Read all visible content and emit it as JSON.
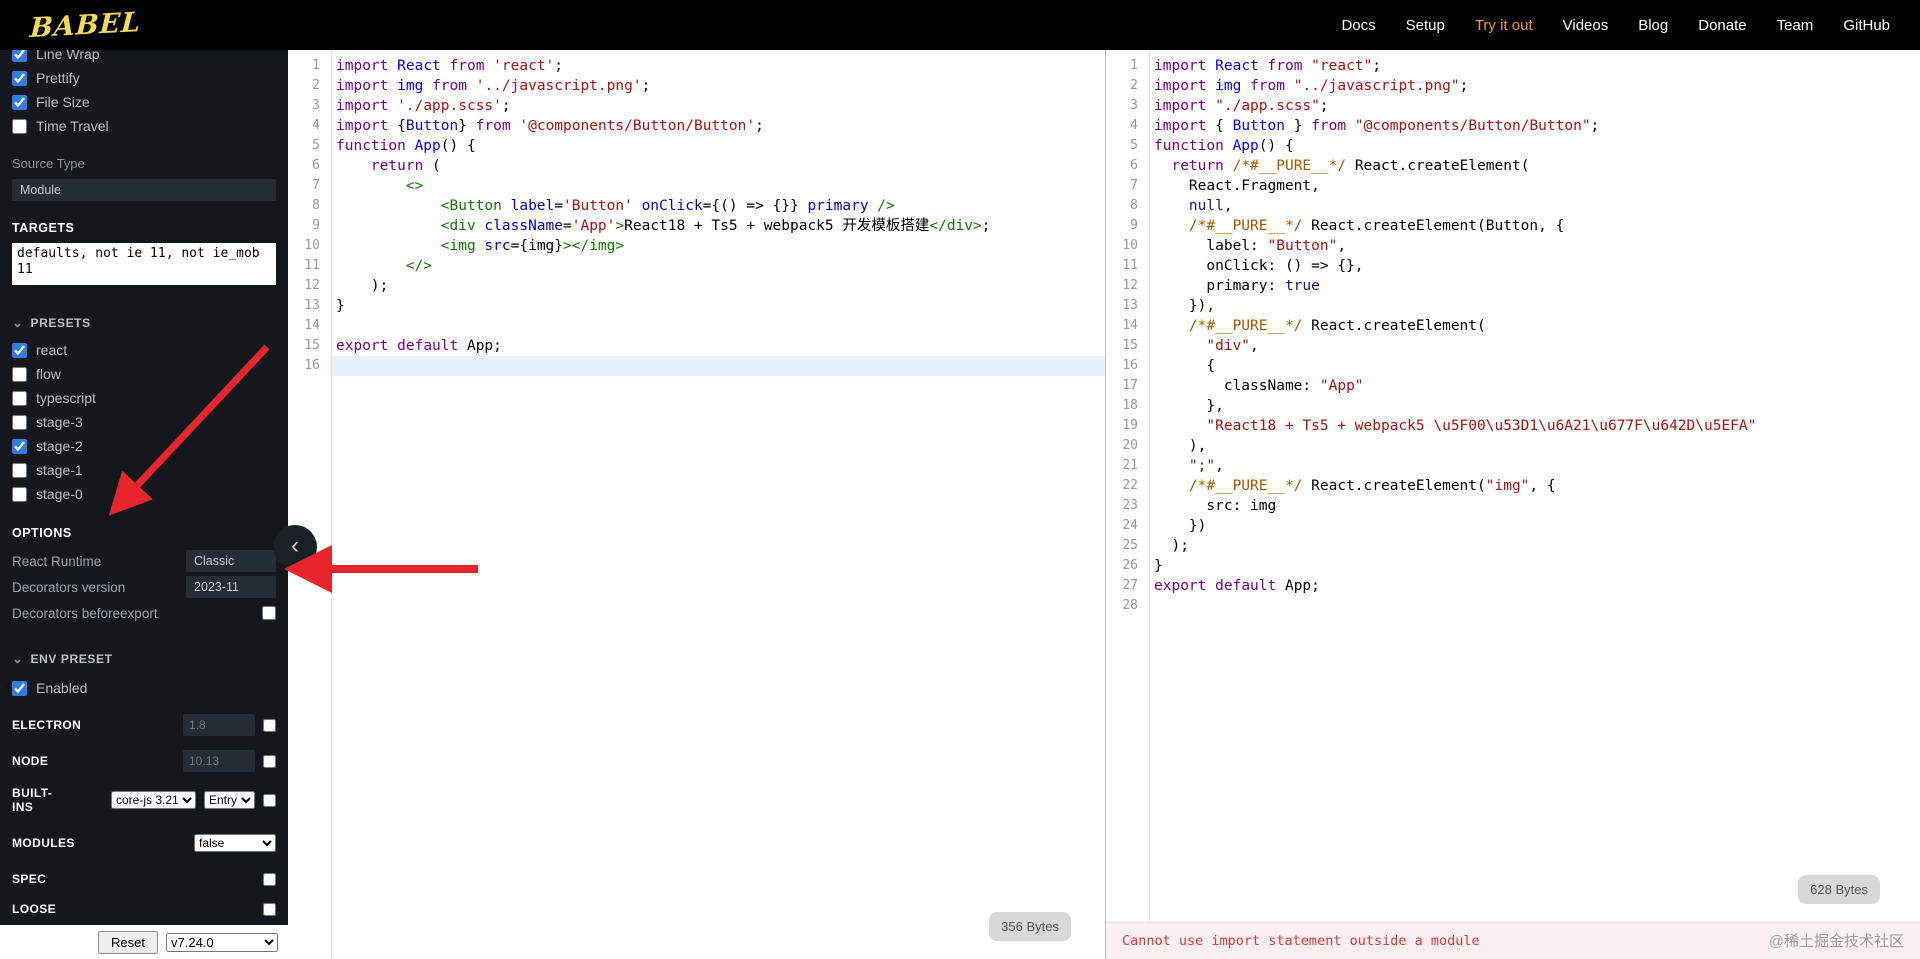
{
  "navbar": {
    "logo": "Babel",
    "items": [
      {
        "label": "Docs",
        "active": false
      },
      {
        "label": "Setup",
        "active": false
      },
      {
        "label": "Try it out",
        "active": true
      },
      {
        "label": "Videos",
        "active": false
      },
      {
        "label": "Blog",
        "active": false
      },
      {
        "label": "Donate",
        "active": false
      },
      {
        "label": "Team",
        "active": false
      },
      {
        "label": "GitHub",
        "active": false
      }
    ]
  },
  "sidebar": {
    "toggles": [
      {
        "label": "Line Wrap",
        "checked": true
      },
      {
        "label": "Prettify",
        "checked": true
      },
      {
        "label": "File Size",
        "checked": true
      },
      {
        "label": "Time Travel",
        "checked": false
      }
    ],
    "source_type": {
      "label": "Source Type",
      "value": "Module"
    },
    "targets": {
      "label": "TARGETS",
      "value": "defaults, not ie 11, not ie_mob 11"
    },
    "presets": {
      "label": "PRESETS",
      "items": [
        {
          "label": "react",
          "checked": true
        },
        {
          "label": "flow",
          "checked": false
        },
        {
          "label": "typescript",
          "checked": false
        },
        {
          "label": "stage-3",
          "checked": false
        },
        {
          "label": "stage-2",
          "checked": true
        },
        {
          "label": "stage-1",
          "checked": false
        },
        {
          "label": "stage-0",
          "checked": false
        }
      ]
    },
    "options": {
      "label": "OPTIONS",
      "react_runtime": {
        "label": "React Runtime",
        "value": "Classic"
      },
      "decorators_version": {
        "label": "Decorators version",
        "value": "2023-11"
      },
      "decorators_before_export": {
        "label": "Decorators beforeexport",
        "checked": false
      }
    },
    "env_preset": {
      "label": "ENV PRESET",
      "enabled": {
        "label": "Enabled",
        "checked": true
      },
      "electron": {
        "label": "ELECTRON",
        "value": "1.8",
        "checked": false
      },
      "node": {
        "label": "NODE",
        "value": "10.13",
        "checked": false
      },
      "builtins": {
        "label": "BUILT-INS",
        "select1": "core-js 3.21",
        "select2": "Entry",
        "checked": false
      },
      "modules": {
        "label": "MODULES",
        "value": "false"
      },
      "spec": {
        "label": "SPEC",
        "checked": false
      },
      "loose": {
        "label": "LOOSE",
        "checked": false
      }
    },
    "footer": {
      "reset_label": "Reset",
      "version": "v7.24.0"
    }
  },
  "editor": {
    "file_size": "356 Bytes",
    "active_line": 16,
    "lines": [
      [
        [
          "k",
          "import"
        ],
        [
          "p",
          " "
        ],
        [
          "d",
          "React"
        ],
        [
          "p",
          " "
        ],
        [
          "k",
          "from"
        ],
        [
          "p",
          " "
        ],
        [
          "s",
          "'react'"
        ],
        [
          "p",
          ";"
        ]
      ],
      [
        [
          "k",
          "import"
        ],
        [
          "p",
          " "
        ],
        [
          "d",
          "img"
        ],
        [
          "p",
          " "
        ],
        [
          "k",
          "from"
        ],
        [
          "p",
          " "
        ],
        [
          "s",
          "'../javascript.png'"
        ],
        [
          "p",
          ";"
        ]
      ],
      [
        [
          "k",
          "import"
        ],
        [
          "p",
          " "
        ],
        [
          "s",
          "'./app.scss'"
        ],
        [
          "p",
          ";"
        ]
      ],
      [
        [
          "k",
          "import"
        ],
        [
          "p",
          " {"
        ],
        [
          "d",
          "Button"
        ],
        [
          "p",
          "} "
        ],
        [
          "k",
          "from"
        ],
        [
          "p",
          " "
        ],
        [
          "s",
          "'@components/Button/Button'"
        ],
        [
          "p",
          ";"
        ]
      ],
      [
        [
          "k",
          "function"
        ],
        [
          "p",
          " "
        ],
        [
          "d",
          "App"
        ],
        [
          "p",
          "() {"
        ]
      ],
      [
        [
          "p",
          "    "
        ],
        [
          "k",
          "return"
        ],
        [
          "p",
          " ("
        ]
      ],
      [
        [
          "p",
          "        "
        ],
        [
          "t",
          "<>"
        ]
      ],
      [
        [
          "p",
          "            "
        ],
        [
          "t",
          "<Button"
        ],
        [
          "p",
          " "
        ],
        [
          "a",
          "label"
        ],
        [
          "p",
          "="
        ],
        [
          "s",
          "'Button'"
        ],
        [
          "p",
          " "
        ],
        [
          "a",
          "onClick"
        ],
        [
          "p",
          "={() => {}} "
        ],
        [
          "a",
          "primary"
        ],
        [
          "p",
          " "
        ],
        [
          "t",
          "/>"
        ]
      ],
      [
        [
          "p",
          "            "
        ],
        [
          "t",
          "<div"
        ],
        [
          "p",
          " "
        ],
        [
          "a",
          "className"
        ],
        [
          "p",
          "="
        ],
        [
          "s",
          "'App'"
        ],
        [
          "t",
          ">"
        ],
        [
          "p",
          "React18 + Ts5 + webpack5 开发模板搭建"
        ],
        [
          "t",
          "</div>"
        ],
        [
          "p",
          ";"
        ]
      ],
      [
        [
          "p",
          "            "
        ],
        [
          "t",
          "<img"
        ],
        [
          "p",
          " "
        ],
        [
          "a",
          "src"
        ],
        [
          "p",
          "={img}"
        ],
        [
          "t",
          "></img>"
        ]
      ],
      [
        [
          "p",
          "        "
        ],
        [
          "t",
          "</>"
        ]
      ],
      [
        [
          "p",
          "    );"
        ]
      ],
      [
        [
          "p",
          "}"
        ]
      ],
      [],
      [
        [
          "k",
          "export"
        ],
        [
          "p",
          " "
        ],
        [
          "k",
          "default"
        ],
        [
          "p",
          " App;"
        ]
      ],
      []
    ]
  },
  "output": {
    "file_size": "628 Bytes",
    "error": "Cannot use import statement outside a module",
    "lines": [
      [
        [
          "k",
          "import"
        ],
        [
          "p",
          " "
        ],
        [
          "d",
          "React"
        ],
        [
          "p",
          " "
        ],
        [
          "k",
          "from"
        ],
        [
          "p",
          " "
        ],
        [
          "s",
          "\"react\""
        ],
        [
          "p",
          ";"
        ]
      ],
      [
        [
          "k",
          "import"
        ],
        [
          "p",
          " "
        ],
        [
          "d",
          "img"
        ],
        [
          "p",
          " "
        ],
        [
          "k",
          "from"
        ],
        [
          "p",
          " "
        ],
        [
          "s",
          "\"../javascript.png\""
        ],
        [
          "p",
          ";"
        ]
      ],
      [
        [
          "k",
          "import"
        ],
        [
          "p",
          " "
        ],
        [
          "s",
          "\"./app.scss\""
        ],
        [
          "p",
          ";"
        ]
      ],
      [
        [
          "k",
          "import"
        ],
        [
          "p",
          " { "
        ],
        [
          "d",
          "Button"
        ],
        [
          "p",
          " } "
        ],
        [
          "k",
          "from"
        ],
        [
          "p",
          " "
        ],
        [
          "s",
          "\"@components/Button/Button\""
        ],
        [
          "p",
          ";"
        ]
      ],
      [
        [
          "k",
          "function"
        ],
        [
          "p",
          " "
        ],
        [
          "d",
          "App"
        ],
        [
          "p",
          "() {"
        ]
      ],
      [
        [
          "p",
          "  "
        ],
        [
          "k",
          "return"
        ],
        [
          "p",
          " "
        ],
        [
          "c",
          "/*#__PURE__*/"
        ],
        [
          "p",
          " React.createElement("
        ]
      ],
      [
        [
          "p",
          "    React.Fragment,"
        ]
      ],
      [
        [
          "p",
          "    "
        ],
        [
          "m",
          "null"
        ],
        [
          "p",
          ","
        ]
      ],
      [
        [
          "p",
          "    "
        ],
        [
          "c",
          "/*#__PURE__*/"
        ],
        [
          "p",
          " React.createElement(Button, {"
        ]
      ],
      [
        [
          "p",
          "      label: "
        ],
        [
          "s",
          "\"Button\""
        ],
        [
          "p",
          ","
        ]
      ],
      [
        [
          "p",
          "      onClick: () => {},"
        ]
      ],
      [
        [
          "p",
          "      primary: "
        ],
        [
          "m",
          "true"
        ]
      ],
      [
        [
          "p",
          "    }),"
        ]
      ],
      [
        [
          "p",
          "    "
        ],
        [
          "c",
          "/*#__PURE__*/"
        ],
        [
          "p",
          " React.createElement("
        ]
      ],
      [
        [
          "p",
          "      "
        ],
        [
          "s",
          "\"div\""
        ],
        [
          "p",
          ","
        ]
      ],
      [
        [
          "p",
          "      {"
        ]
      ],
      [
        [
          "p",
          "        className: "
        ],
        [
          "s",
          "\"App\""
        ]
      ],
      [
        [
          "p",
          "      },"
        ]
      ],
      [
        [
          "p",
          "      "
        ],
        [
          "s",
          "\"React18 + Ts5 + webpack5 \\u5F00\\u53D1\\u6A21\\u677F\\u642D\\u5EFA\""
        ]
      ],
      [
        [
          "p",
          "    ),"
        ]
      ],
      [
        [
          "p",
          "    "
        ],
        [
          "s",
          "\";\""
        ],
        [
          "p",
          ","
        ]
      ],
      [
        [
          "p",
          "    "
        ],
        [
          "c",
          "/*#__PURE__*/"
        ],
        [
          "p",
          " React.createElement("
        ],
        [
          "s",
          "\"img\""
        ],
        [
          "p",
          ", {"
        ]
      ],
      [
        [
          "p",
          "      src: img"
        ]
      ],
      [
        [
          "p",
          "    })"
        ]
      ],
      [
        [
          "p",
          "  );"
        ]
      ],
      [
        [
          "p",
          "}"
        ]
      ],
      [
        [
          "k",
          "export"
        ],
        [
          "p",
          " "
        ],
        [
          "k",
          "default"
        ],
        [
          "p",
          " App;"
        ]
      ],
      []
    ]
  },
  "watermark": "@稀土掘金技术社区",
  "colors": {
    "nav_active": "#ef9b35",
    "logo_yellow": "#f5da55",
    "arrow_red": "#e8252c",
    "error_red": "#d8383f",
    "checkbox_blue": "#2b7de9",
    "active_line_bg": "#e8f2fe"
  }
}
